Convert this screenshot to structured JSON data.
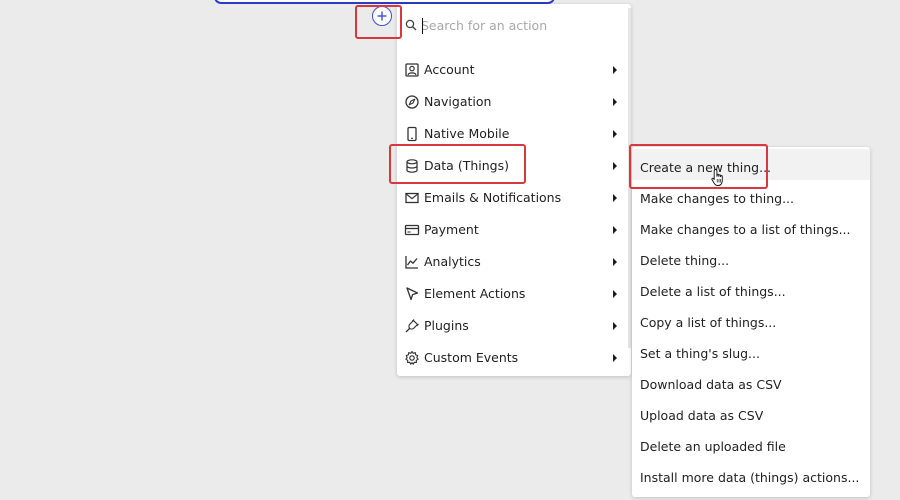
{
  "search": {
    "placeholder": "Search for an action"
  },
  "menu": {
    "items": [
      {
        "label": "Account",
        "icon": "account-icon"
      },
      {
        "label": "Navigation",
        "icon": "compass-icon"
      },
      {
        "label": "Native Mobile",
        "icon": "mobile-icon"
      },
      {
        "label": "Data (Things)",
        "icon": "database-icon"
      },
      {
        "label": "Emails & Notifications",
        "icon": "mail-icon"
      },
      {
        "label": "Payment",
        "icon": "credit-card-icon"
      },
      {
        "label": "Analytics",
        "icon": "chart-icon"
      },
      {
        "label": "Element Actions",
        "icon": "pointer-icon"
      },
      {
        "label": "Plugins",
        "icon": "plug-icon"
      },
      {
        "label": "Custom Events",
        "icon": "gear-icon"
      }
    ]
  },
  "submenu": {
    "items": [
      {
        "label": "Create a new thing..."
      },
      {
        "label": "Make changes to thing..."
      },
      {
        "label": "Make changes to a list of things..."
      },
      {
        "label": "Delete thing..."
      },
      {
        "label": "Delete a list of things..."
      },
      {
        "label": "Copy a list of things..."
      },
      {
        "label": "Set a thing's slug..."
      },
      {
        "label": "Download data as CSV"
      },
      {
        "label": "Upload data as CSV"
      },
      {
        "label": "Delete an uploaded file"
      },
      {
        "label": "Install more data (things) actions..."
      }
    ]
  },
  "colors": {
    "accent": "#3b4fd1",
    "highlight": "#d7373d",
    "background": "#ebebeb"
  }
}
